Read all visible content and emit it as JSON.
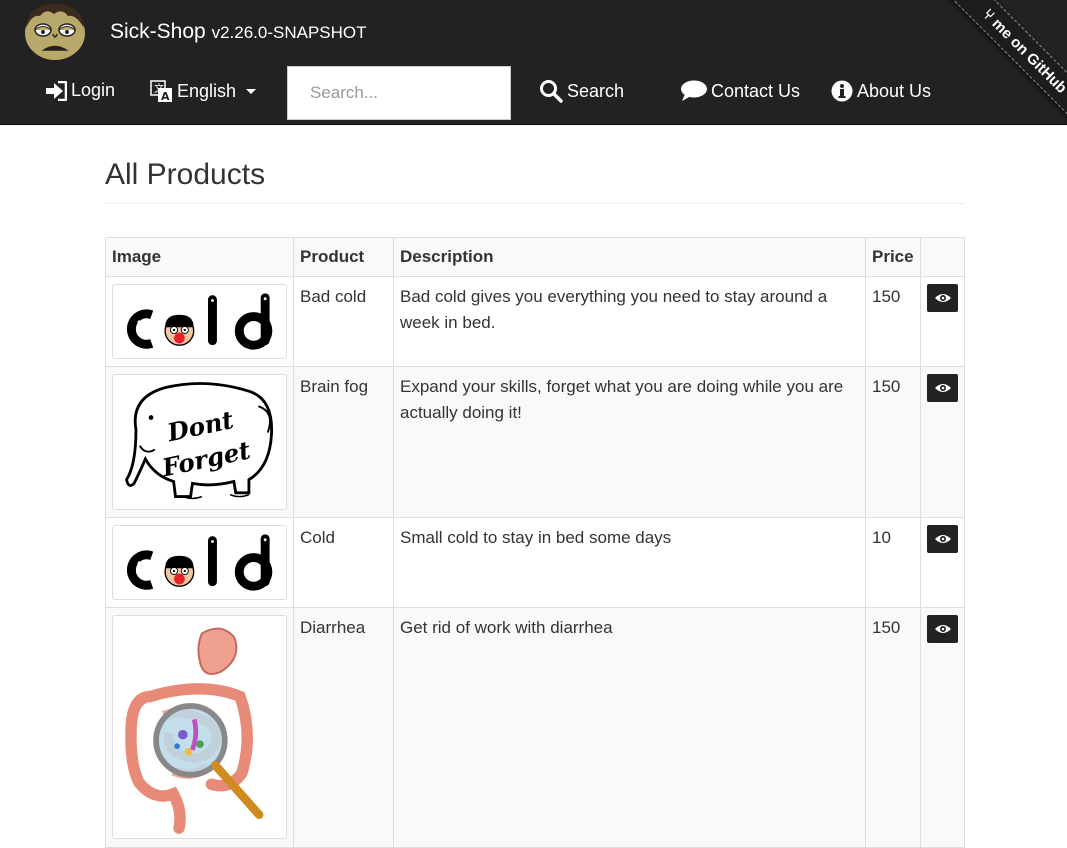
{
  "navbar": {
    "brand": "Sick-Shop",
    "version": "v2.26.0-SNAPSHOT",
    "login": "Login",
    "language": "English",
    "search_placeholder": "Search...",
    "search_button": "Search",
    "contact": "Contact Us",
    "about": "About Us",
    "github_ribbon": "me on GitHub",
    "colors": {
      "background": "#222222",
      "text": "#ffffff"
    }
  },
  "page": {
    "title": "All Products"
  },
  "table": {
    "headers": [
      "Image",
      "Product",
      "Description",
      "Price",
      ""
    ],
    "rows": [
      {
        "image": "cold-image",
        "product": "Bad cold",
        "description": "Bad cold gives you everything you need to stay around a week in bed.",
        "price": "150",
        "action_icon": "eye-icon"
      },
      {
        "image": "elephant-dont-forget-image",
        "product": "Brain fog",
        "description": "Expand your skills, forget what you are doing while you are actually doing it!",
        "price": "150",
        "action_icon": "eye-icon"
      },
      {
        "image": "cold-image",
        "product": "Cold",
        "description": "Small cold to stay in bed some days",
        "price": "10",
        "action_icon": "eye-icon"
      },
      {
        "image": "intestines-magnifier-image",
        "product": "Diarrhea",
        "description": "Get rid of work with diarrhea",
        "price": "150",
        "action_icon": "eye-icon"
      }
    ]
  }
}
